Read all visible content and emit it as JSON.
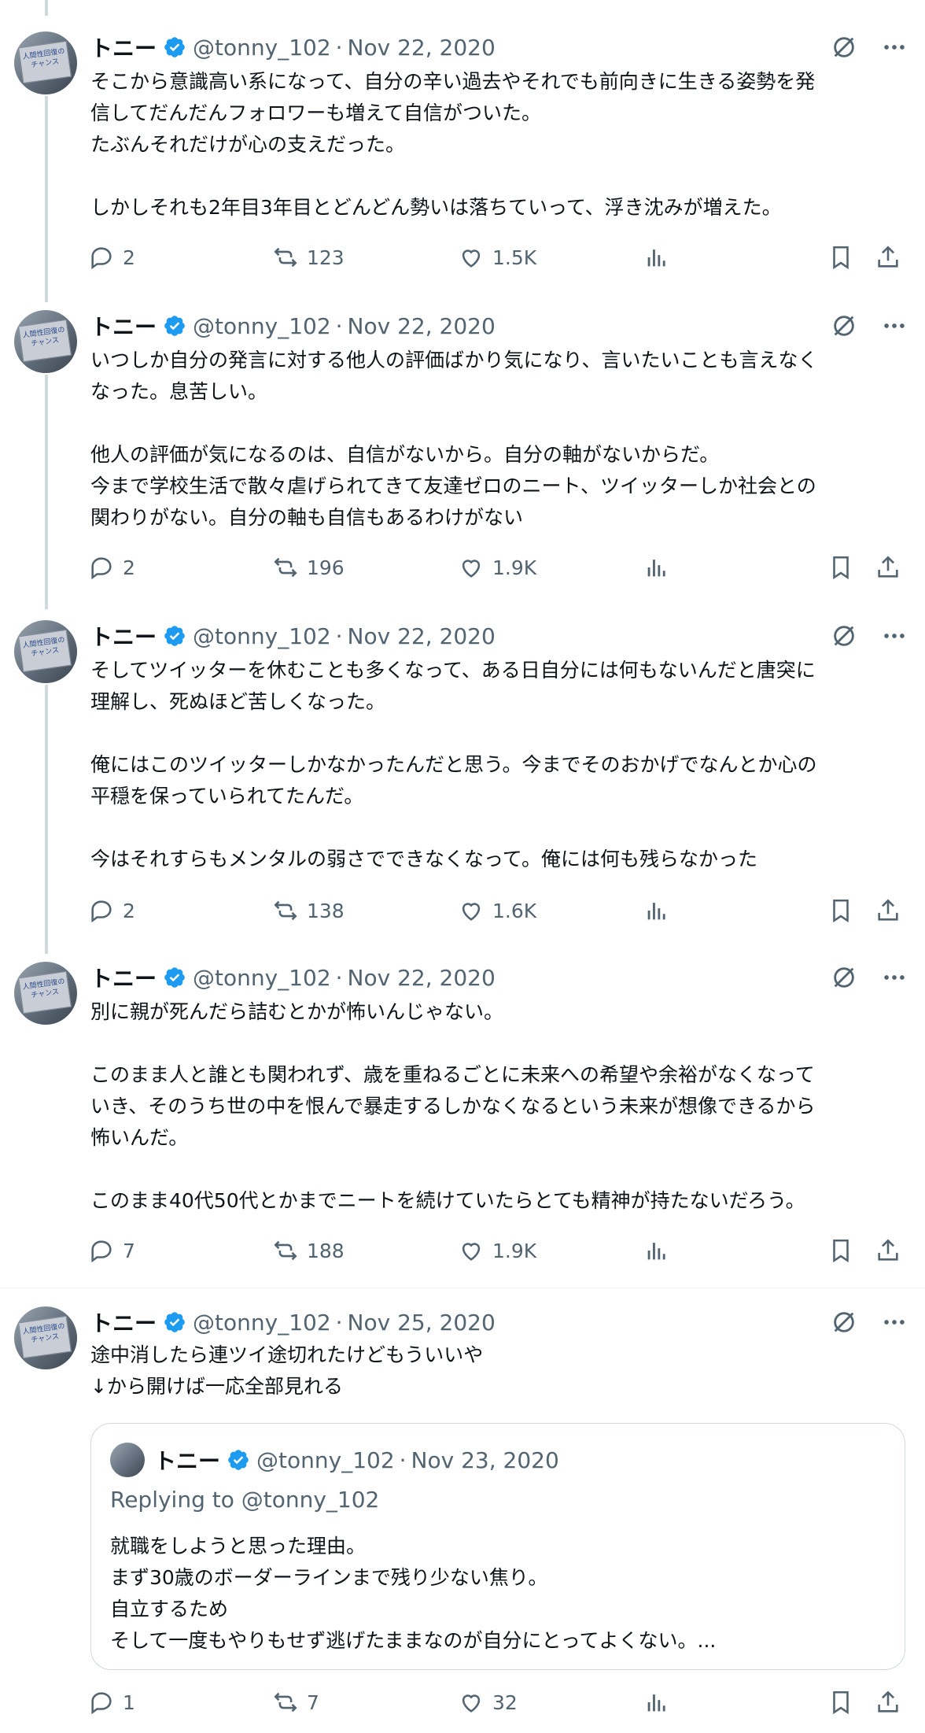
{
  "colors": {
    "verified": "#1d9bf0",
    "text": "#0f1419",
    "muted": "#536471",
    "thread_line": "#cfd9de"
  },
  "avatar_sign_text": "人間性回復のチャンス",
  "tweets": [
    {
      "name": "トニー",
      "handle": "@tonny_102",
      "date": "Nov 22, 2020",
      "text": "そこから意識高い系になって、自分の辛い過去やそれでも前向きに生きる姿勢を発\n信してだんだんフォロワーも増えて自信がついた。\nたぶんそれだけが心の支えだった。\n\nしかしそれも2年目3年目とどんどん勢いは落ちていって、浮き沈みが増えた。",
      "replies": "2",
      "retweets": "123",
      "likes": "1.5K"
    },
    {
      "name": "トニー",
      "handle": "@tonny_102",
      "date": "Nov 22, 2020",
      "text": "いつしか自分の発言に対する他人の評価ばかり気になり、言いたいことも言えなく\nなった。息苦しい。\n\n他人の評価が気になるのは、自信がないから。自分の軸がないからだ。\n今まで学校生活で散々虐げられてきて友達ゼロのニート、ツイッターしか社会との\n関わりがない。自分の軸も自信もあるわけがない",
      "replies": "2",
      "retweets": "196",
      "likes": "1.9K"
    },
    {
      "name": "トニー",
      "handle": "@tonny_102",
      "date": "Nov 22, 2020",
      "text": "そしてツイッターを休むことも多くなって、ある日自分には何もないんだと唐突に\n理解し、死ぬほど苦しくなった。\n\n俺にはこのツイッターしかなかったんだと思う。今までそのおかげでなんとか心の\n平穏を保っていられてたんだ。\n\n今はそれすらもメンタルの弱さでできなくなって。俺には何も残らなかった",
      "replies": "2",
      "retweets": "138",
      "likes": "1.6K"
    },
    {
      "name": "トニー",
      "handle": "@tonny_102",
      "date": "Nov 22, 2020",
      "text": "別に親が死んだら詰むとかが怖いんじゃない。\n\nこのまま人と誰とも関われず、歳を重ねるごとに未来への希望や余裕がなくなって\nいき、そのうち世の中を恨んで暴走するしかなくなるという未来が想像できるから\n怖いんだ。\n\nこのまま40代50代とかまでニートを続けていたらとても精神が持たないだろう。",
      "replies": "7",
      "retweets": "188",
      "likes": "1.9K"
    },
    {
      "name": "トニー",
      "handle": "@tonny_102",
      "date": "Nov 25, 2020",
      "text": "途中消したら連ツイ途切れたけどもういいや\n↓から開けば一応全部見れる",
      "replies": "1",
      "retweets": "7",
      "likes": "32",
      "quote": {
        "name": "トニー",
        "handle": "@tonny_102",
        "date": "Nov 23, 2020",
        "replying": "Replying to @tonny_102",
        "text": "就職をしようと思った理由。\nまず30歳のボーダーラインまで残り少ない焦り。\n自立するため\nそして一度もやりもせず逃げたままなのが自分にとってよくない。..."
      }
    }
  ]
}
